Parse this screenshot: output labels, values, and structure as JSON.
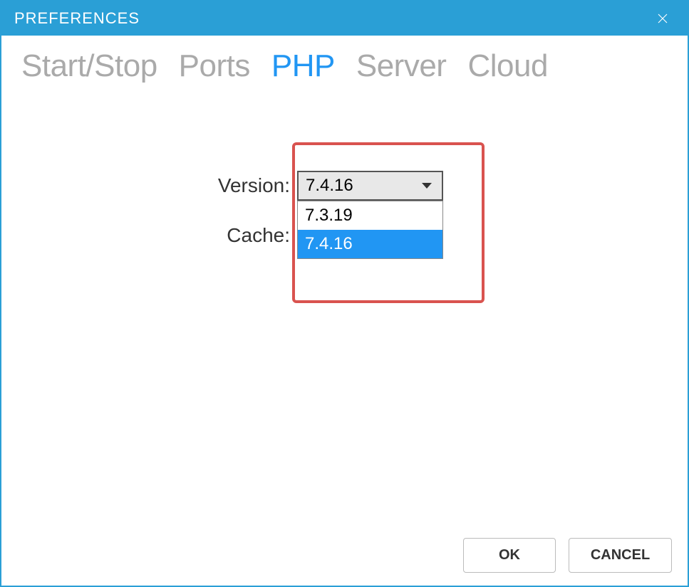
{
  "titlebar": {
    "title": "PREFERENCES"
  },
  "tabs": [
    {
      "label": "Start/Stop",
      "active": false
    },
    {
      "label": "Ports",
      "active": false
    },
    {
      "label": "PHP",
      "active": true
    },
    {
      "label": "Server",
      "active": false
    },
    {
      "label": "Cloud",
      "active": false
    }
  ],
  "form": {
    "version_label": "Version:",
    "cache_label": "Cache:",
    "version_selected": "7.4.16",
    "version_options": [
      {
        "value": "7.3.19",
        "selected": false
      },
      {
        "value": "7.4.16",
        "selected": true
      }
    ]
  },
  "footer": {
    "ok_label": "OK",
    "cancel_label": "CANCEL"
  }
}
